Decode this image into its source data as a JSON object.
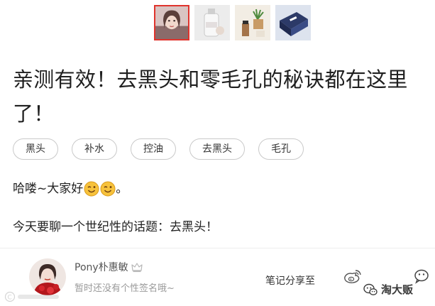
{
  "gallery": {
    "thumbnails": [
      {
        "icon": "portrait-photo",
        "active": true
      },
      {
        "icon": "product-bottle-photo",
        "active": false
      },
      {
        "icon": "cosmetics-plant-photo",
        "active": false
      },
      {
        "icon": "product-box-photo",
        "active": false
      }
    ]
  },
  "article": {
    "title": "亲测有效！去黑头和零毛孔的秘诀都在这里了！",
    "tags": [
      "黑头",
      "补水",
      "控油",
      "去黑头",
      "毛孔"
    ],
    "paragraph1_text": "哈喽~大家好",
    "paragraph1_suffix": "。",
    "paragraph1_emojis": [
      "wink-face-icon",
      "wink-face-icon"
    ],
    "paragraph2": "今天要聊一个世纪性的话题：去黑头！"
  },
  "author": {
    "name": "Pony朴惠敏",
    "badge_icon": "crown-icon",
    "signature": "暂时还没有个性签名哦~"
  },
  "share": {
    "label": "笔记分享至",
    "icons": [
      "weibo-icon",
      "wechat-icon"
    ]
  },
  "watermark": {
    "right_text": "淘大贩"
  },
  "colors": {
    "active_thumb_border": "#e0342d",
    "tag_border": "#c9c9c9",
    "secondary_text": "#9a9a9a"
  }
}
